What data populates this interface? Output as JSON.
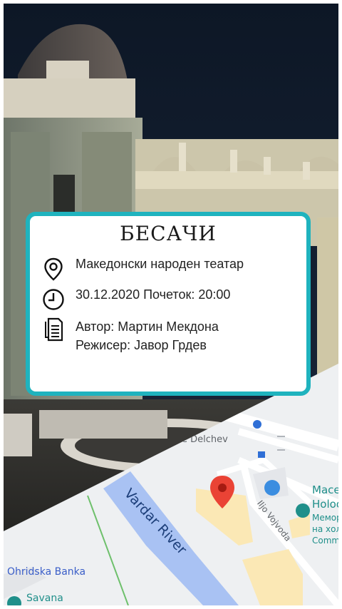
{
  "event": {
    "title": "БЕСАЧИ",
    "venue": "Македонски народен театар",
    "datetime": "30.12.2020 Почеток: 20:00",
    "author": "Автор: Мартин Мекдона",
    "director": "Режисер: Јавор Грдев",
    "accent_color": "#1fb3be"
  },
  "icons": {
    "venue": "location-pin-icon",
    "time": "clock-icon",
    "credits": "document-icon"
  },
  "map": {
    "river_label": "Vardar River",
    "street_delchev": "e Delchev",
    "street_ilijo": "Iljo Vojvoda",
    "poi_ohridska": "Ohridska Banka",
    "poi_savana": "Savana",
    "poi_mace": "Mace",
    "poi_holoc": "Holoc",
    "poi_memor": "Мемор",
    "poi_naholo": "на холо",
    "poi_comm": "Comm",
    "marker_color": "#ea4335"
  }
}
